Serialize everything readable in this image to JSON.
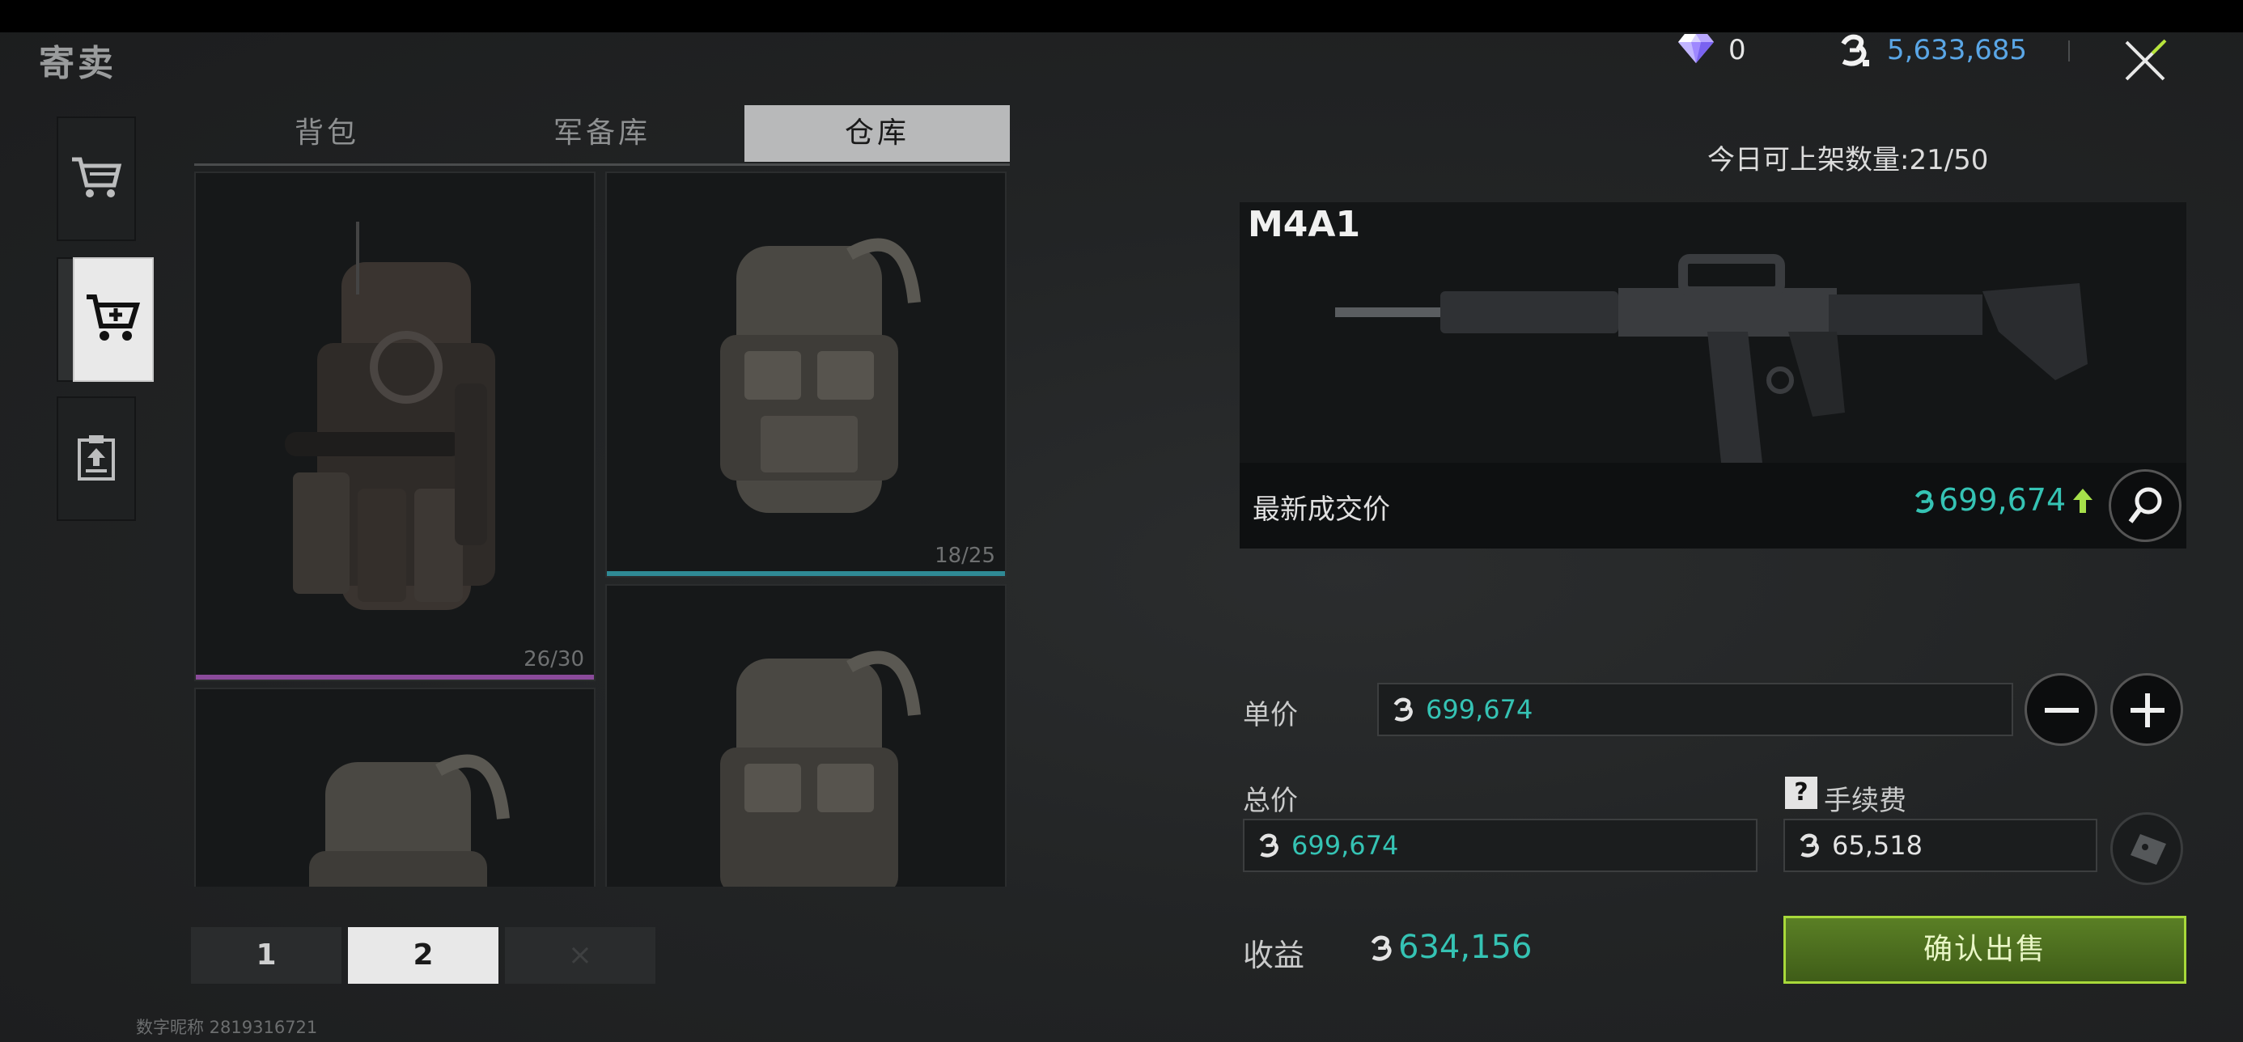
{
  "header": {
    "title": "寄卖",
    "gems": "0",
    "balance": "5,633,685"
  },
  "rail": {
    "items": [
      {
        "icon": "cart-icon"
      },
      {
        "icon": "cart-sell-icon",
        "active": true
      },
      {
        "icon": "clipboard-upload-icon"
      }
    ]
  },
  "tabs": [
    {
      "label": "背包"
    },
    {
      "label": "军备库"
    },
    {
      "label": "仓库",
      "active": true
    }
  ],
  "grid": {
    "items": [
      {
        "count": "26/30",
        "rarity_color": "#8a4a9a"
      },
      {
        "count": "18/25",
        "rarity_color": "#2f8a95"
      },
      {
        "count": ""
      },
      {
        "count": ""
      }
    ]
  },
  "pager": {
    "pages": [
      "1",
      "2",
      "×"
    ],
    "active_index": 1
  },
  "footer": {
    "nickname": "数字昵称 2819316721"
  },
  "sell": {
    "daily_limit": "今日可上架数量:21/50",
    "item_name": "M4A1",
    "latest_label": "最新成交价",
    "latest_price": "699,674",
    "unit_price_label": "单价",
    "unit_price": "699,674",
    "total_label": "总价",
    "total_price": "699,674",
    "fee_label": "手续费",
    "fee": "65,518",
    "profit_label": "收益",
    "profit": "634,156",
    "confirm_label": "确认出售"
  },
  "colors": {
    "accent_teal": "#35c3b4",
    "balance_blue": "#5aa6e6",
    "confirm_green": "#a8d93a"
  }
}
